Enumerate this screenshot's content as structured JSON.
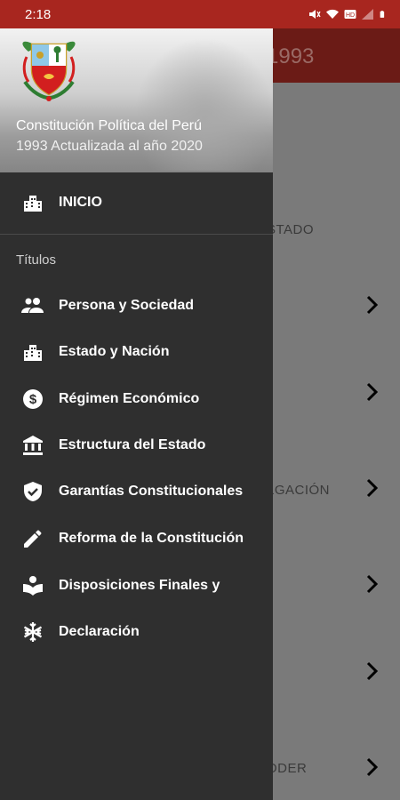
{
  "status_bar": {
    "time": "2:18",
    "icons": [
      "mute-icon",
      "wifi-icon",
      "hd-icon",
      "signal-icon",
      "battery-icon"
    ]
  },
  "background_app": {
    "title": "1993",
    "rows": [
      {
        "text": "STADO"
      },
      {
        "text": ""
      },
      {
        "text": ""
      },
      {
        "text": "LGACIÓN"
      },
      {
        "text": ""
      },
      {
        "text": ""
      },
      {
        "text": "ODER"
      }
    ]
  },
  "drawer": {
    "header": {
      "title": "Constitución Política del Perú",
      "subtitle": "1993 Actualizada al año 2020"
    },
    "home": {
      "label": "INICIO",
      "icon": "building-icon"
    },
    "section_label": "Títulos",
    "items": [
      {
        "label": "Persona y Sociedad",
        "icon": "people-icon"
      },
      {
        "label": "Estado y Nación",
        "icon": "building-icon"
      },
      {
        "label": "Régimen Económico",
        "icon": "dollar-circle-icon"
      },
      {
        "label": "Estructura del Estado",
        "icon": "bank-icon"
      },
      {
        "label": "Garantías Constitucionales",
        "icon": "shield-check-icon"
      },
      {
        "label": "Reforma de la Constitución",
        "icon": "pencil-icon"
      },
      {
        "label": "Disposiciones Finales y",
        "icon": "book-reader-icon"
      },
      {
        "label": "Declaración",
        "icon": "snowflake-icon"
      }
    ]
  },
  "colors": {
    "status_bar": "#a8261f",
    "drawer_bg": "#2f2f2f",
    "toolbar_bg": "#6b1b16"
  }
}
